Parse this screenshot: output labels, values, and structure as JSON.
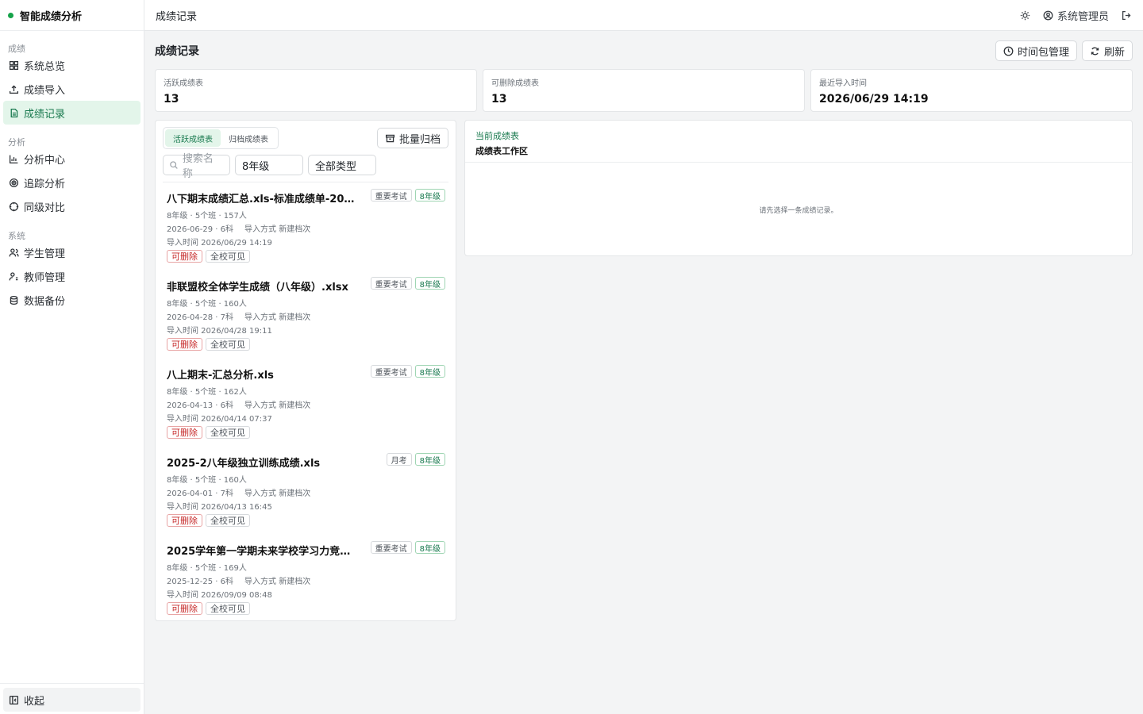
{
  "app": {
    "title": "智能成绩分析"
  },
  "sidebar": {
    "sections": [
      {
        "label": "成绩",
        "items": [
          {
            "label": "系统总览",
            "icon": "grid-icon",
            "active": false
          },
          {
            "label": "成绩导入",
            "icon": "upload-icon",
            "active": false
          },
          {
            "label": "成绩记录",
            "icon": "document-icon",
            "active": true
          }
        ]
      },
      {
        "label": "分析",
        "items": [
          {
            "label": "分析中心",
            "icon": "bar-chart-icon",
            "active": false
          },
          {
            "label": "追踪分析",
            "icon": "target-icon",
            "active": false
          },
          {
            "label": "同级对比",
            "icon": "crosshair-icon",
            "active": false
          }
        ]
      },
      {
        "label": "系统",
        "items": [
          {
            "label": "学生管理",
            "icon": "users-icon",
            "active": false
          },
          {
            "label": "教师管理",
            "icon": "user-settings-icon",
            "active": false
          },
          {
            "label": "数据备份",
            "icon": "database-icon",
            "active": false
          }
        ]
      }
    ],
    "collapse_label": "收起"
  },
  "topbar": {
    "title": "成绩记录",
    "user": "系统管理员"
  },
  "page": {
    "title": "成绩记录",
    "actions": {
      "time_pack": "时间包管理",
      "refresh": "刷新"
    }
  },
  "stats": [
    {
      "label": "活跃成绩表",
      "value": "13"
    },
    {
      "label": "可删除成绩表",
      "value": "13"
    },
    {
      "label": "最近导入时间",
      "value": "2026/06/29 14:19"
    }
  ],
  "list": {
    "tabs": [
      {
        "label": "活跃成绩表",
        "active": true
      },
      {
        "label": "归档成绩表",
        "active": false
      }
    ],
    "archive_button": "批量归档",
    "search_placeholder": "搜索名称",
    "grade_filter": "8年级",
    "type_filter": "全部类型",
    "records": [
      {
        "title": "八下期末成绩汇总.xls-标准成绩单-202…",
        "tags": [
          "重要考试",
          "8年级"
        ],
        "meta": "8年级 · 5个班 · 157人",
        "date": "2026-06-29 · 6科",
        "import_mode": "导入方式 新建档次",
        "import_time": "导入时间 2026/06/29 14:19",
        "badges": [
          "可删除",
          "全校可见"
        ]
      },
      {
        "title": "非联盟校全体学生成绩（八年级）.xlsx",
        "tags": [
          "重要考试",
          "8年级"
        ],
        "meta": "8年级 · 5个班 · 160人",
        "date": "2026-04-28 · 7科",
        "import_mode": "导入方式 新建档次",
        "import_time": "导入时间 2026/04/28 19:11",
        "badges": [
          "可删除",
          "全校可见"
        ]
      },
      {
        "title": "八上期末-汇总分析.xls",
        "tags": [
          "重要考试",
          "8年级"
        ],
        "meta": "8年级 · 5个班 · 162人",
        "date": "2026-04-13 · 6科",
        "import_mode": "导入方式 新建档次",
        "import_time": "导入时间 2026/04/14 07:37",
        "badges": [
          "可删除",
          "全校可见"
        ]
      },
      {
        "title": "2025-2八年级独立训练成绩.xls",
        "tags": [
          "月考",
          "8年级"
        ],
        "meta": "8年级 · 5个班 · 160人",
        "date": "2026-04-01 · 7科",
        "import_mode": "导入方式 新建档次",
        "import_time": "导入时间 2026/04/13 16:45",
        "badges": [
          "可删除",
          "全校可见"
        ]
      },
      {
        "title": "2025学年第一学期未来学校学习力竞赛…",
        "tags": [
          "重要考试",
          "8年级"
        ],
        "meta": "8年级 · 5个班 · 169人",
        "date": "2025-12-25 · 6科",
        "import_mode": "导入方式 新建档次",
        "import_time": "导入时间 2026/09/09 08:48",
        "badges": [
          "可删除",
          "全校可见"
        ]
      }
    ]
  },
  "detail": {
    "label": "当前成绩表",
    "title": "成绩表工作区",
    "empty_text": "请先选择一条成绩记录。"
  },
  "colors": {
    "accent": "#16a34a",
    "accent_bg": "#e3f5ea",
    "danger": "#c62828"
  }
}
